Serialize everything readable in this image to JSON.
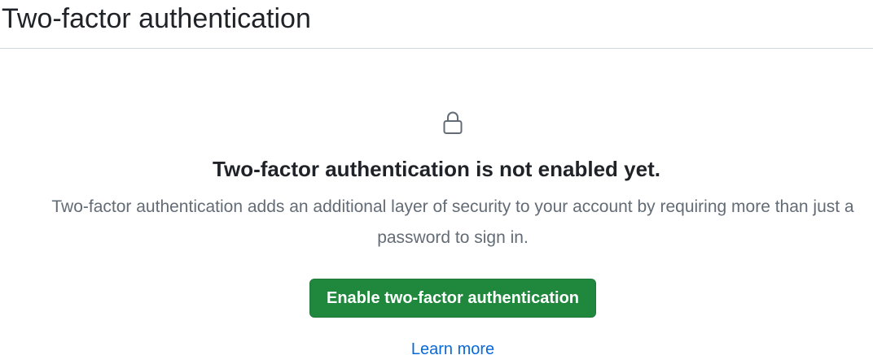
{
  "header": {
    "title": "Two-factor authentication"
  },
  "blankslate": {
    "icon": "lock-icon",
    "heading": "Two-factor authentication is not enabled yet.",
    "description": "Two-factor authentication adds an additional layer of security to your account by requiring more than just a password to sign in.",
    "primary_button_label": "Enable two-factor authentication",
    "learn_more_label": "Learn more"
  },
  "colors": {
    "primary_button": "#1f883d",
    "link": "#0969da",
    "muted_text": "#636c76",
    "border": "#d0d7de"
  }
}
